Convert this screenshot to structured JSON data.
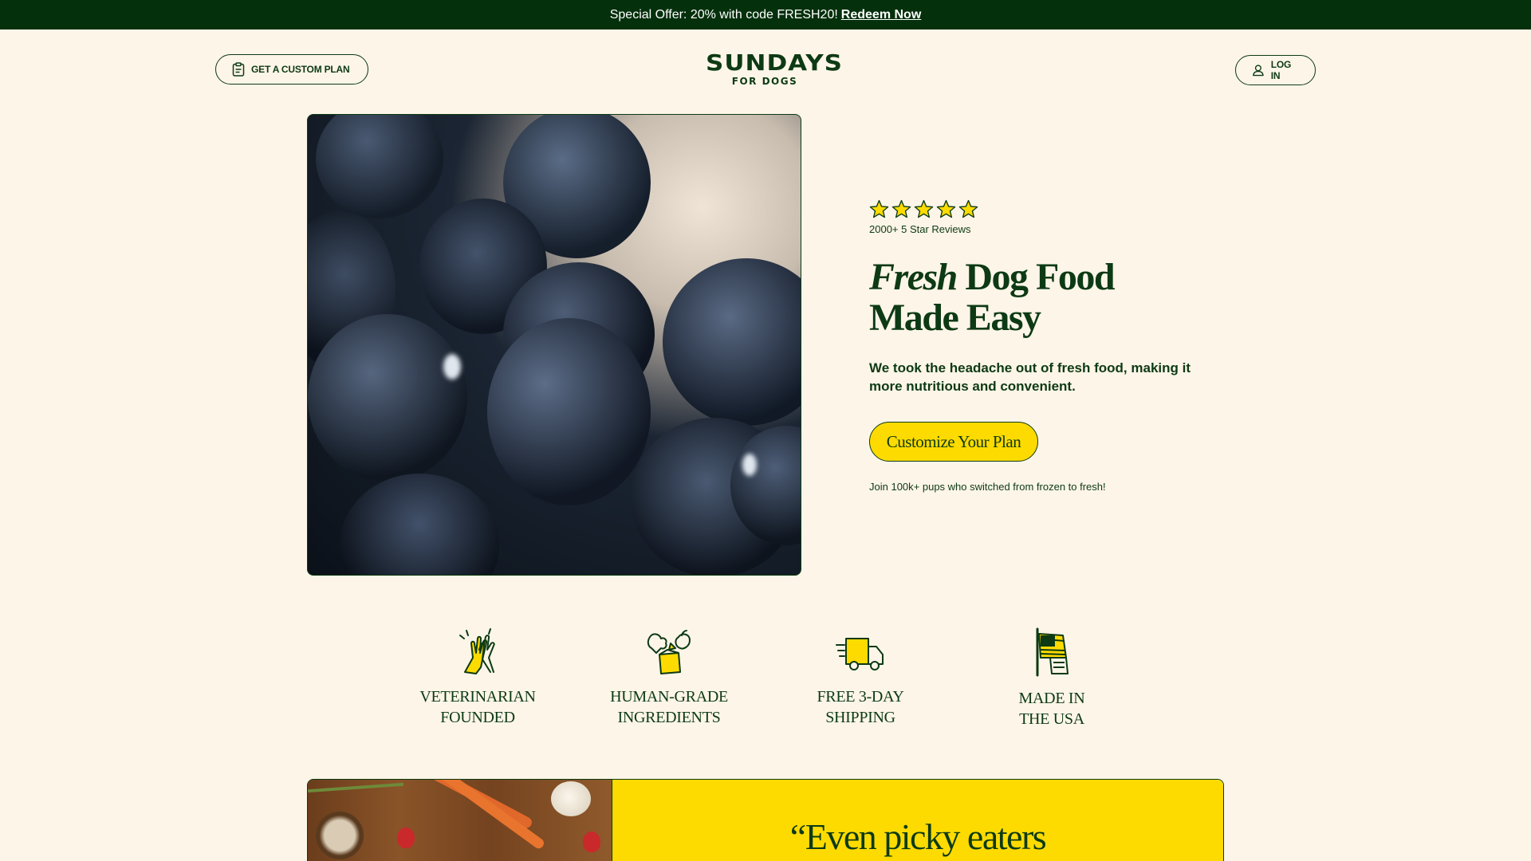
{
  "promo": {
    "text": "Special Offer: 20% with code FRESH20!",
    "link": "Redeem Now"
  },
  "header": {
    "custom_plan_label": "GET A CUSTOM PLAN",
    "logo_line1": "SUNDAYS",
    "logo_line2": "FOR DOGS",
    "login_label": "LOG IN"
  },
  "hero": {
    "rating_stars": 5,
    "reviews": "2000+ 5 Star Reviews",
    "title_italic": "Fresh",
    "title_rest": " Dog Food",
    "title_line2": "Made Easy",
    "subtitle": "We took the headache out of fresh food, making it more nutritious and convenient.",
    "cta_label": "Customize Your Plan",
    "join_text": "Join 100k+ pups who switched from frozen to fresh!"
  },
  "features": [
    {
      "line1": "Veterinarian",
      "line2": "Founded",
      "icon": "high-five-icon"
    },
    {
      "line1": "Human-Grade",
      "line2": "Ingredients",
      "icon": "ingredients-icon"
    },
    {
      "line1": "Free 3-Day",
      "line2": "Shipping",
      "icon": "delivery-truck-icon"
    },
    {
      "line1": "Made in",
      "line2": "the USA",
      "icon": "usa-flag-icon"
    }
  ],
  "testimonial": {
    "quote": "“Even picky eaters"
  },
  "colors": {
    "dark_green": "#05300c",
    "text_green": "#0d3a14",
    "background": "#fdf5e8",
    "accent_yellow": "#fedb00"
  }
}
